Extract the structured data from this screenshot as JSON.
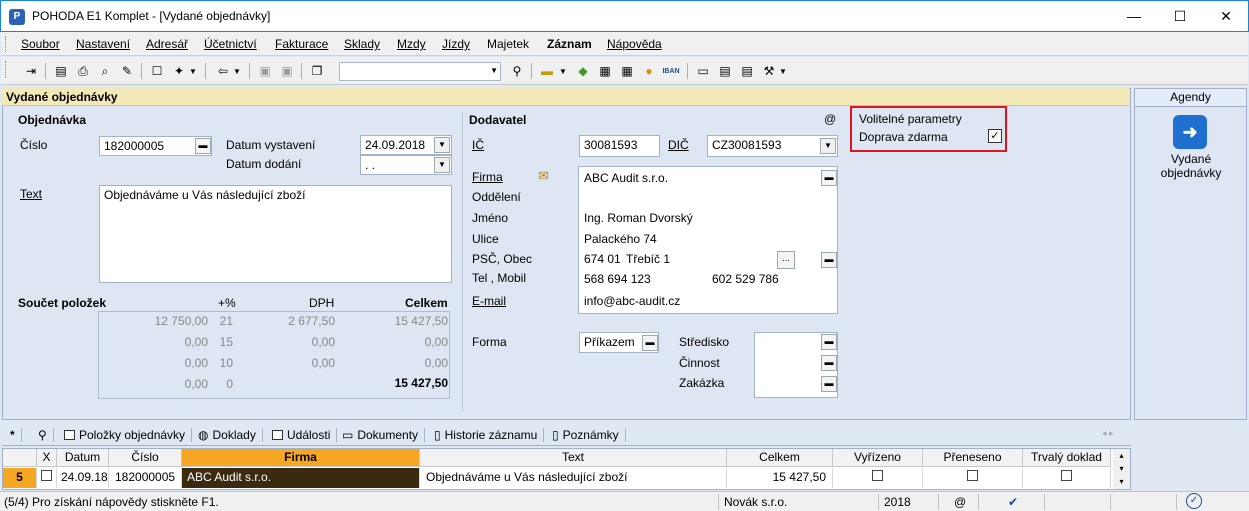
{
  "window": {
    "title": "POHODA E1 Komplet - [Vydané objednávky]",
    "min": "—",
    "max": "☐",
    "close": "✕"
  },
  "menu": [
    "Soubor",
    "Nastavení",
    "Adresář",
    "Účetnictví",
    "Fakturace",
    "Sklady",
    "Mzdy",
    "Jízdy",
    "Majetek",
    "Záznam",
    "Nápověda"
  ],
  "agenda_title": "Vydané objednávky",
  "objednavka": {
    "section": "Objednávka",
    "cislo_label": "Číslo",
    "cislo": "182000005",
    "datum_vystaveni_label": "Datum vystavení",
    "datum_vystaveni": "24.09.2018",
    "datum_dodani_label": "Datum dodání",
    "datum_dodani": ". .",
    "text_label": "Text",
    "text": "Objednáváme u Vás následující zboží"
  },
  "soucet": {
    "section": "Součet položek",
    "h_rate": "+%",
    "h_dph": "DPH",
    "h_celkem": "Celkem",
    "rows": [
      {
        "zaklad": "12 750,00",
        "sazba": "21",
        "dph": "2 677,50",
        "celkem": "15 427,50"
      },
      {
        "zaklad": "0,00",
        "sazba": "15",
        "dph": "0,00",
        "celkem": "0,00"
      },
      {
        "zaklad": "0,00",
        "sazba": "10",
        "dph": "0,00",
        "celkem": "0,00"
      },
      {
        "zaklad": "0,00",
        "sazba": "0",
        "dph": "",
        "celkem": "15 427,50"
      }
    ]
  },
  "dodavatel": {
    "section": "Dodavatel",
    "at": "@",
    "ic_label": "IČ",
    "ic": "30081593",
    "dic_label": "DIČ",
    "dic": "CZ30081593",
    "firma_label": "Firma",
    "firma": "ABC Audit s.r.o.",
    "oddeleni_label": "Oddělení",
    "jmeno_label": "Jméno",
    "jmeno": "Ing. Roman Dvorský",
    "ulice_label": "Ulice",
    "ulice": "Palackého 74",
    "psc_label": "PSČ, Obec",
    "psc": "674 01",
    "obec": "Třebíč 1",
    "tel_label": "Tel , Mobil",
    "tel": "568 694 123",
    "mobil": "602 529 786",
    "email_label": "E-mail",
    "email": "info@abc-audit.cz",
    "forma_label": "Forma",
    "forma": "Příkazem",
    "stredisko_label": "Středisko",
    "cinnost_label": "Činnost",
    "zakazka_label": "Zakázka"
  },
  "volitelne": {
    "title": "Volitelné parametry",
    "doprava": "Doprava zdarma",
    "checked": true
  },
  "agendy": {
    "head": "Agendy",
    "item": "Vydané objednávky"
  },
  "tabs": [
    "Položky objednávky",
    "Doklady",
    "Události",
    "Dokumenty",
    "Historie záznamu",
    "Poznámky"
  ],
  "tabs_star": "*",
  "grid": {
    "headers": [
      "X",
      "Datum",
      "Číslo",
      "Firma",
      "Text",
      "Celkem",
      "Vyřízeno",
      "Přeneseno",
      "Trvalý doklad"
    ],
    "row": {
      "num": "5",
      "datum": "24.09.18",
      "cislo": "182000005",
      "firma": "ABC Audit s.r.o.",
      "text": "Objednáváme u Vás následující zboží",
      "celkem": "15 427,50"
    }
  },
  "status": {
    "hint": "(5/4) Pro získání nápovědy stiskněte F1.",
    "company": "Novák s.r.o.",
    "year": "2018",
    "at": "@"
  },
  "colors": {
    "accent": "#1883d7",
    "highlight": "#e0141e",
    "selected_cell": "#3a2a10",
    "firma_header": "#f5a623"
  }
}
